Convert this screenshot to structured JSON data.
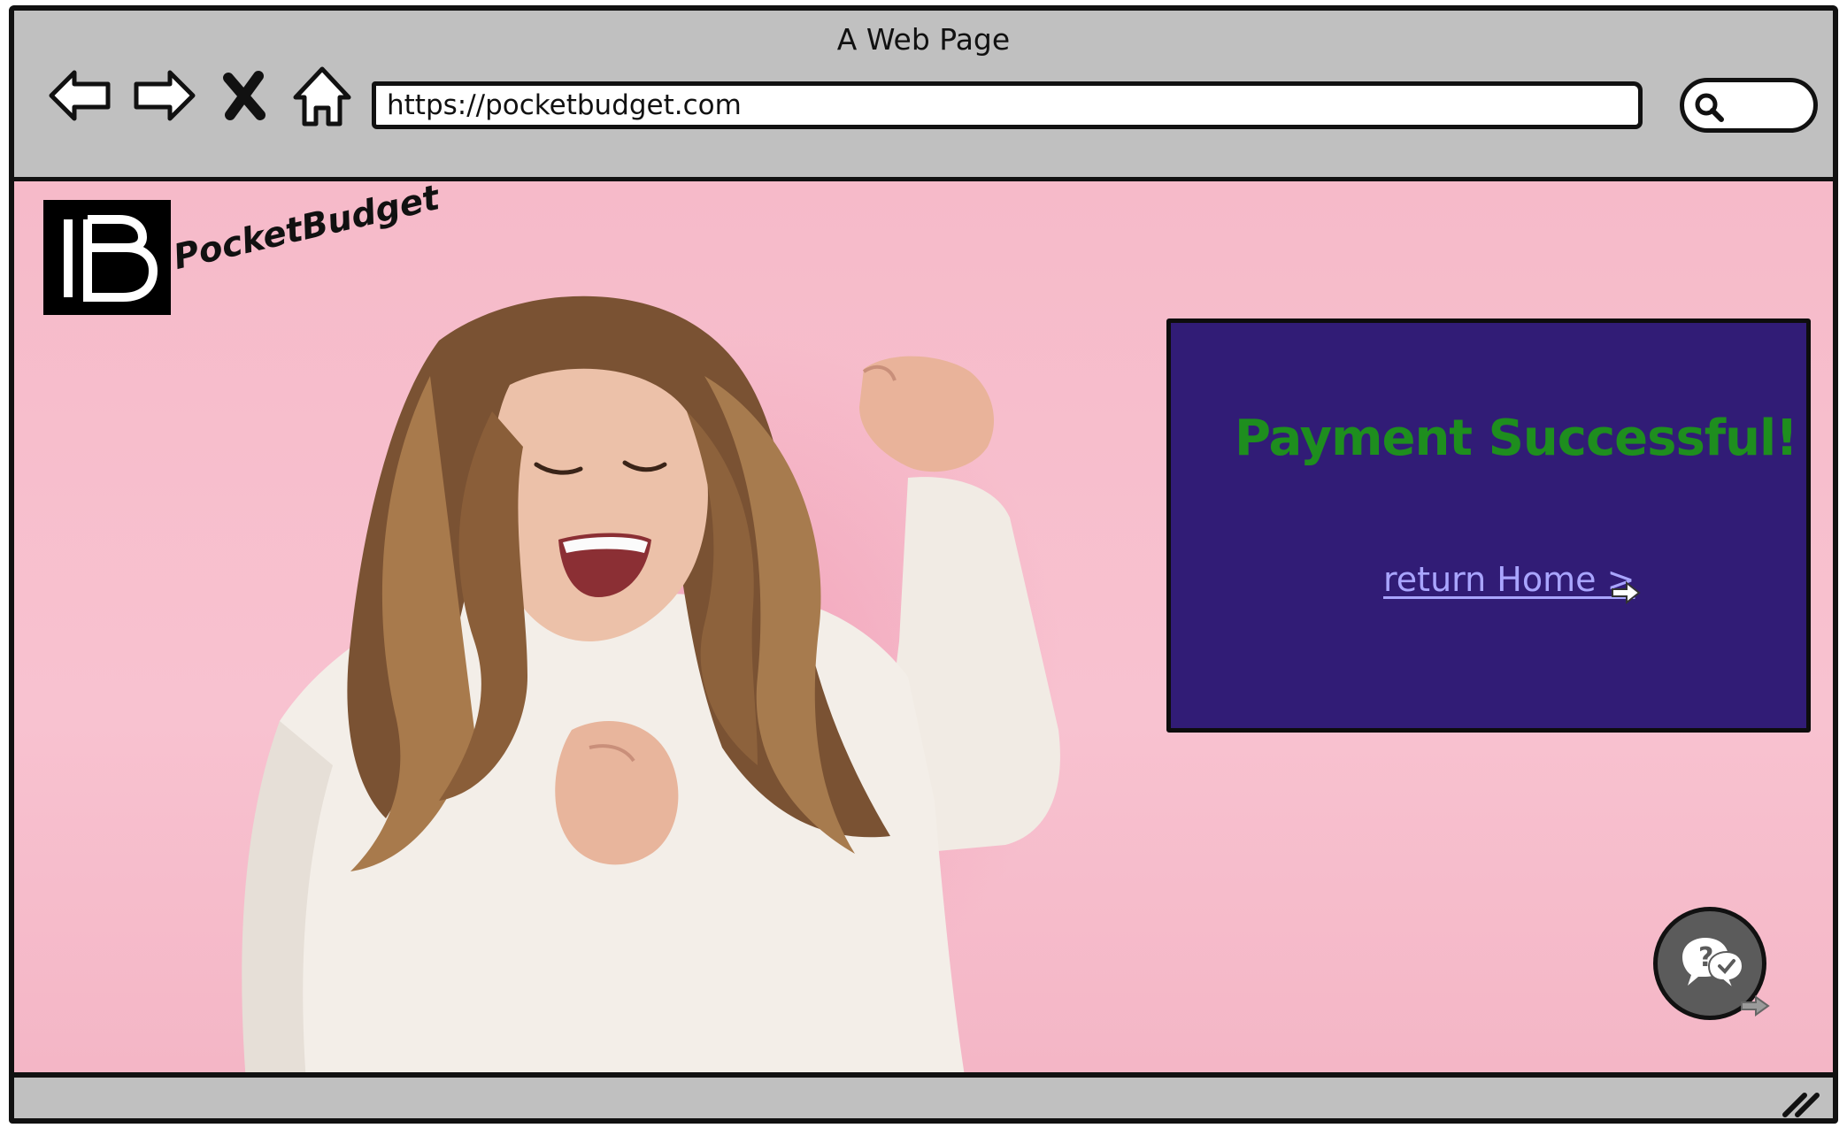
{
  "window": {
    "title": "A Web Page"
  },
  "toolbar": {
    "back_icon": "arrow-left-icon",
    "forward_icon": "arrow-right-icon",
    "stop_icon": "close-icon",
    "home_icon": "home-icon",
    "url": "https://pocketbudget.com",
    "search_icon": "search-icon"
  },
  "page": {
    "brand": {
      "logo_letters": "PB",
      "name": "PocketBudget"
    },
    "hero_image": "woman-celebrating-photo",
    "card": {
      "title": "Payment Successful!",
      "link_label": "return Home >"
    },
    "chat_button_icon": "chat-help-icon"
  },
  "colors": {
    "chrome": "#c0c0c0",
    "page_background": "#f7bccb",
    "card_background": "#311c76",
    "title_text": "#1e8e1e",
    "link_text": "#a9a5ff",
    "chat_button": "#5b5b5b"
  }
}
